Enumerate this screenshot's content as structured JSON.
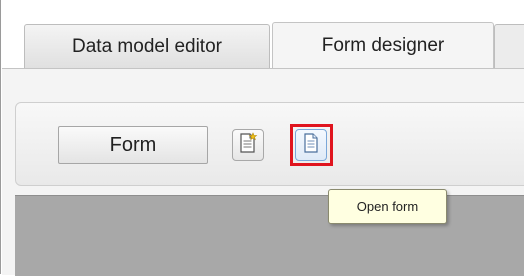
{
  "tabs": [
    {
      "label": "Data model editor",
      "active": false
    },
    {
      "label": "Form designer",
      "active": true
    }
  ],
  "toolbar": {
    "form_button_label": "Form",
    "new_form_icon": "new-document-icon",
    "open_form_icon": "document-icon"
  },
  "tooltip": {
    "text": "Open form"
  },
  "colors": {
    "highlight": "#e0141e",
    "tooltip_bg": "#ffffe1",
    "canvas": "#a8a8a8"
  }
}
